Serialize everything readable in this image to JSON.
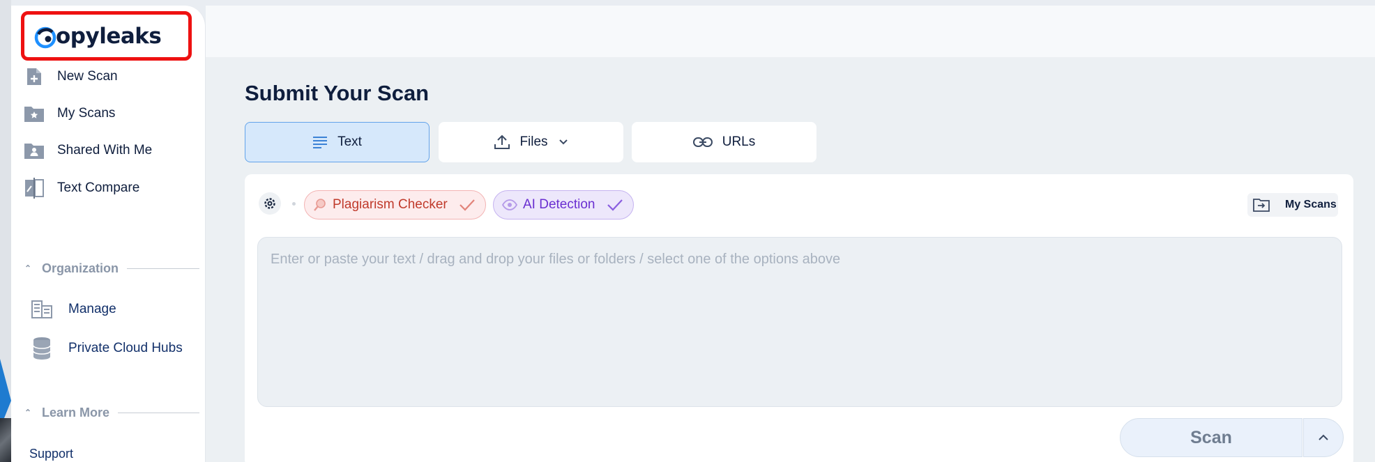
{
  "brand": {
    "name": "opyleaks",
    "logo_text": "Copyleaks"
  },
  "sidebar": {
    "items": [
      {
        "label": "New Scan",
        "icon": "new-scan-icon"
      },
      {
        "label": "My Scans",
        "icon": "folder-star-icon"
      },
      {
        "label": "Shared With Me",
        "icon": "folder-user-icon"
      },
      {
        "label": "Text Compare",
        "icon": "compare-icon"
      }
    ],
    "organization": {
      "label": "Organization",
      "items": [
        {
          "label": "Manage",
          "icon": "manage-icon"
        },
        {
          "label": "Private Cloud Hubs",
          "icon": "database-icon"
        }
      ]
    },
    "learn_more": {
      "label": "Learn More"
    },
    "support_label": "Support"
  },
  "main": {
    "title": "Submit Your Scan",
    "tabs": [
      {
        "label": "Text",
        "active": true
      },
      {
        "label": "Files",
        "active": false
      },
      {
        "label": "URLs",
        "active": false
      }
    ],
    "chips": {
      "plagiarism": "Plagiarism Checker",
      "ai": "AI Detection"
    },
    "my_scans_label": "My Scans",
    "input_placeholder": "Enter or paste your text / drag and drop your files or folders / select one of the options above",
    "scan_label": "Scan"
  },
  "colors": {
    "accent": "#62a3ea",
    "plagiarism": "#c03a2b",
    "ai": "#6a2fd1",
    "logo_frame": "#ee1111"
  }
}
